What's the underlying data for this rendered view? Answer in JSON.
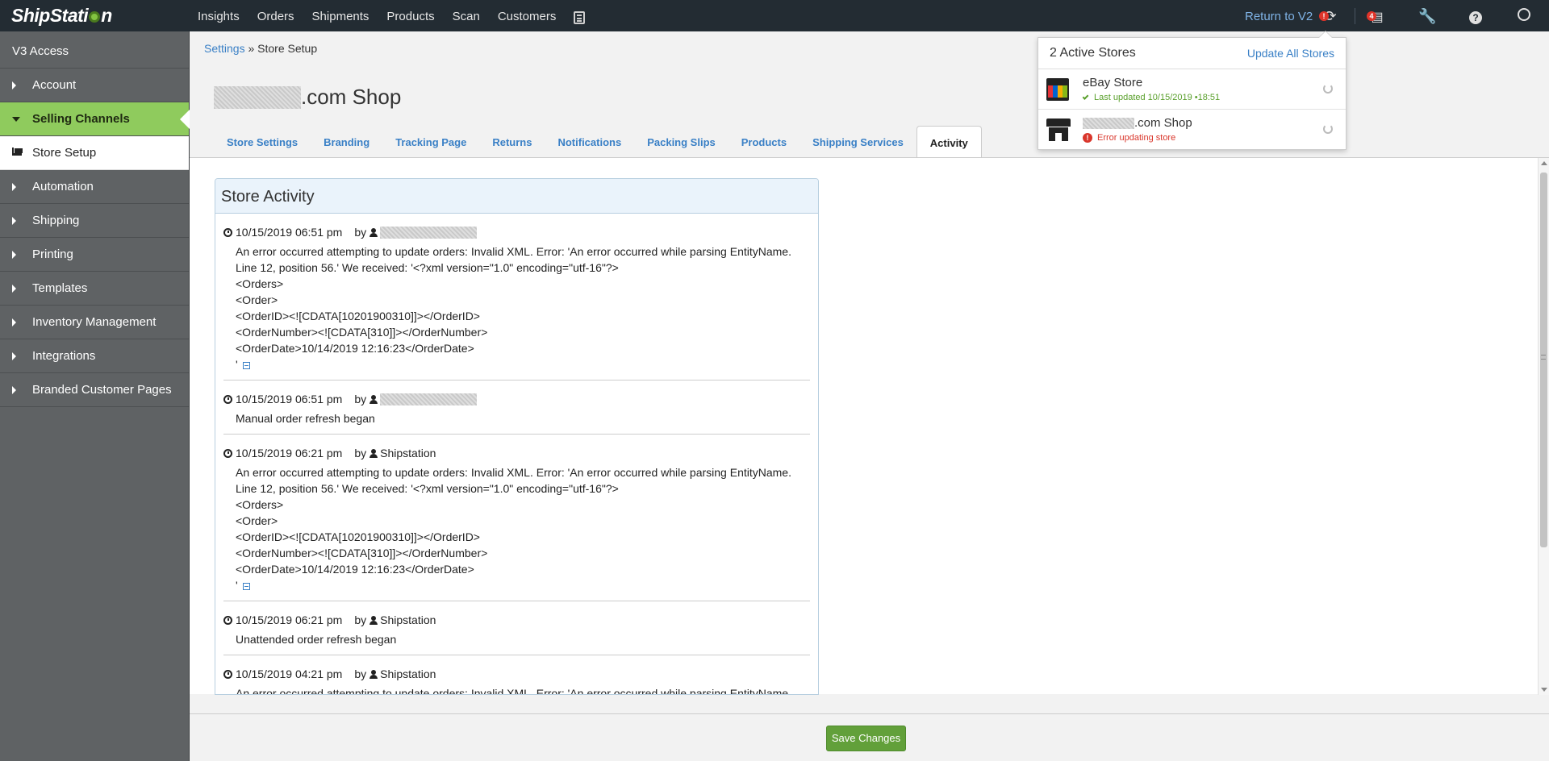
{
  "topbar": {
    "logo": "ShipStation",
    "nav": [
      "Insights",
      "Orders",
      "Shipments",
      "Products",
      "Scan",
      "Customers"
    ],
    "return_label": "Return to V2",
    "print_badge": "4"
  },
  "sidebar": {
    "header": "V3 Access",
    "items": [
      {
        "label": "Account"
      },
      {
        "label": "Selling Channels"
      },
      {
        "label": "Store Setup"
      },
      {
        "label": "Automation"
      },
      {
        "label": "Shipping"
      },
      {
        "label": "Printing"
      },
      {
        "label": "Templates"
      },
      {
        "label": "Inventory Management"
      },
      {
        "label": "Integrations"
      },
      {
        "label": "Branded Customer Pages"
      }
    ]
  },
  "breadcrumb": {
    "parent": "Settings",
    "separator": "»",
    "current": "Store Setup"
  },
  "store": {
    "title_suffix": ".com Shop"
  },
  "tabs": [
    "Store Settings",
    "Branding",
    "Tracking Page",
    "Returns",
    "Notifications",
    "Packing Slips",
    "Products",
    "Shipping Services",
    "Activity"
  ],
  "activity": {
    "title": "Store Activity",
    "by_label": "by",
    "entries": [
      {
        "time": "10/15/2019 06:51 pm",
        "user": "",
        "body": "An error occurred attempting to update orders: Invalid XML. Error: 'An error occurred while parsing EntityName.\nLine 12, position 56.' We received: '<?xml version=\"1.0\" encoding=\"utf-16\"?>\n<Orders>\n<Order>\n<OrderID><![CDATA[10201900310]]></OrderID>\n<OrderNumber><![CDATA[310]]></OrderNumber>\n<OrderDate>10/14/2019 12:16:23</OrderDate>\n'"
      },
      {
        "time": "10/15/2019 06:51 pm",
        "user": "",
        "body": "Manual order refresh began"
      },
      {
        "time": "10/15/2019 06:21 pm",
        "user": "Shipstation",
        "body": "An error occurred attempting to update orders: Invalid XML. Error: 'An error occurred while parsing EntityName.\nLine 12, position 56.' We received: '<?xml version=\"1.0\" encoding=\"utf-16\"?>\n<Orders>\n<Order>\n<OrderID><![CDATA[10201900310]]></OrderID>\n<OrderNumber><![CDATA[310]]></OrderNumber>\n<OrderDate>10/14/2019 12:16:23</OrderDate>\n'"
      },
      {
        "time": "10/15/2019 06:21 pm",
        "user": "Shipstation",
        "body": "Unattended order refresh began"
      },
      {
        "time": "10/15/2019 04:21 pm",
        "user": "Shipstation",
        "body": "An error occurred attempting to update orders: Invalid XML. Error: 'An error occurred while parsing EntityName."
      }
    ]
  },
  "footer": {
    "save_label": "Save Changes"
  },
  "stores_popup": {
    "count_label": "2 Active Stores",
    "update_all": "Update All Stores",
    "stores": [
      {
        "name": "eBay Store",
        "status": "Last updated 10/15/2019 •18:51"
      },
      {
        "name": ".com Shop",
        "status": "Error updating store"
      }
    ]
  },
  "colors": {
    "accent_green": "#8fcb5d",
    "link_blue": "#3a80c6",
    "save_green": "#62a03a",
    "error_red": "#d9362b"
  }
}
